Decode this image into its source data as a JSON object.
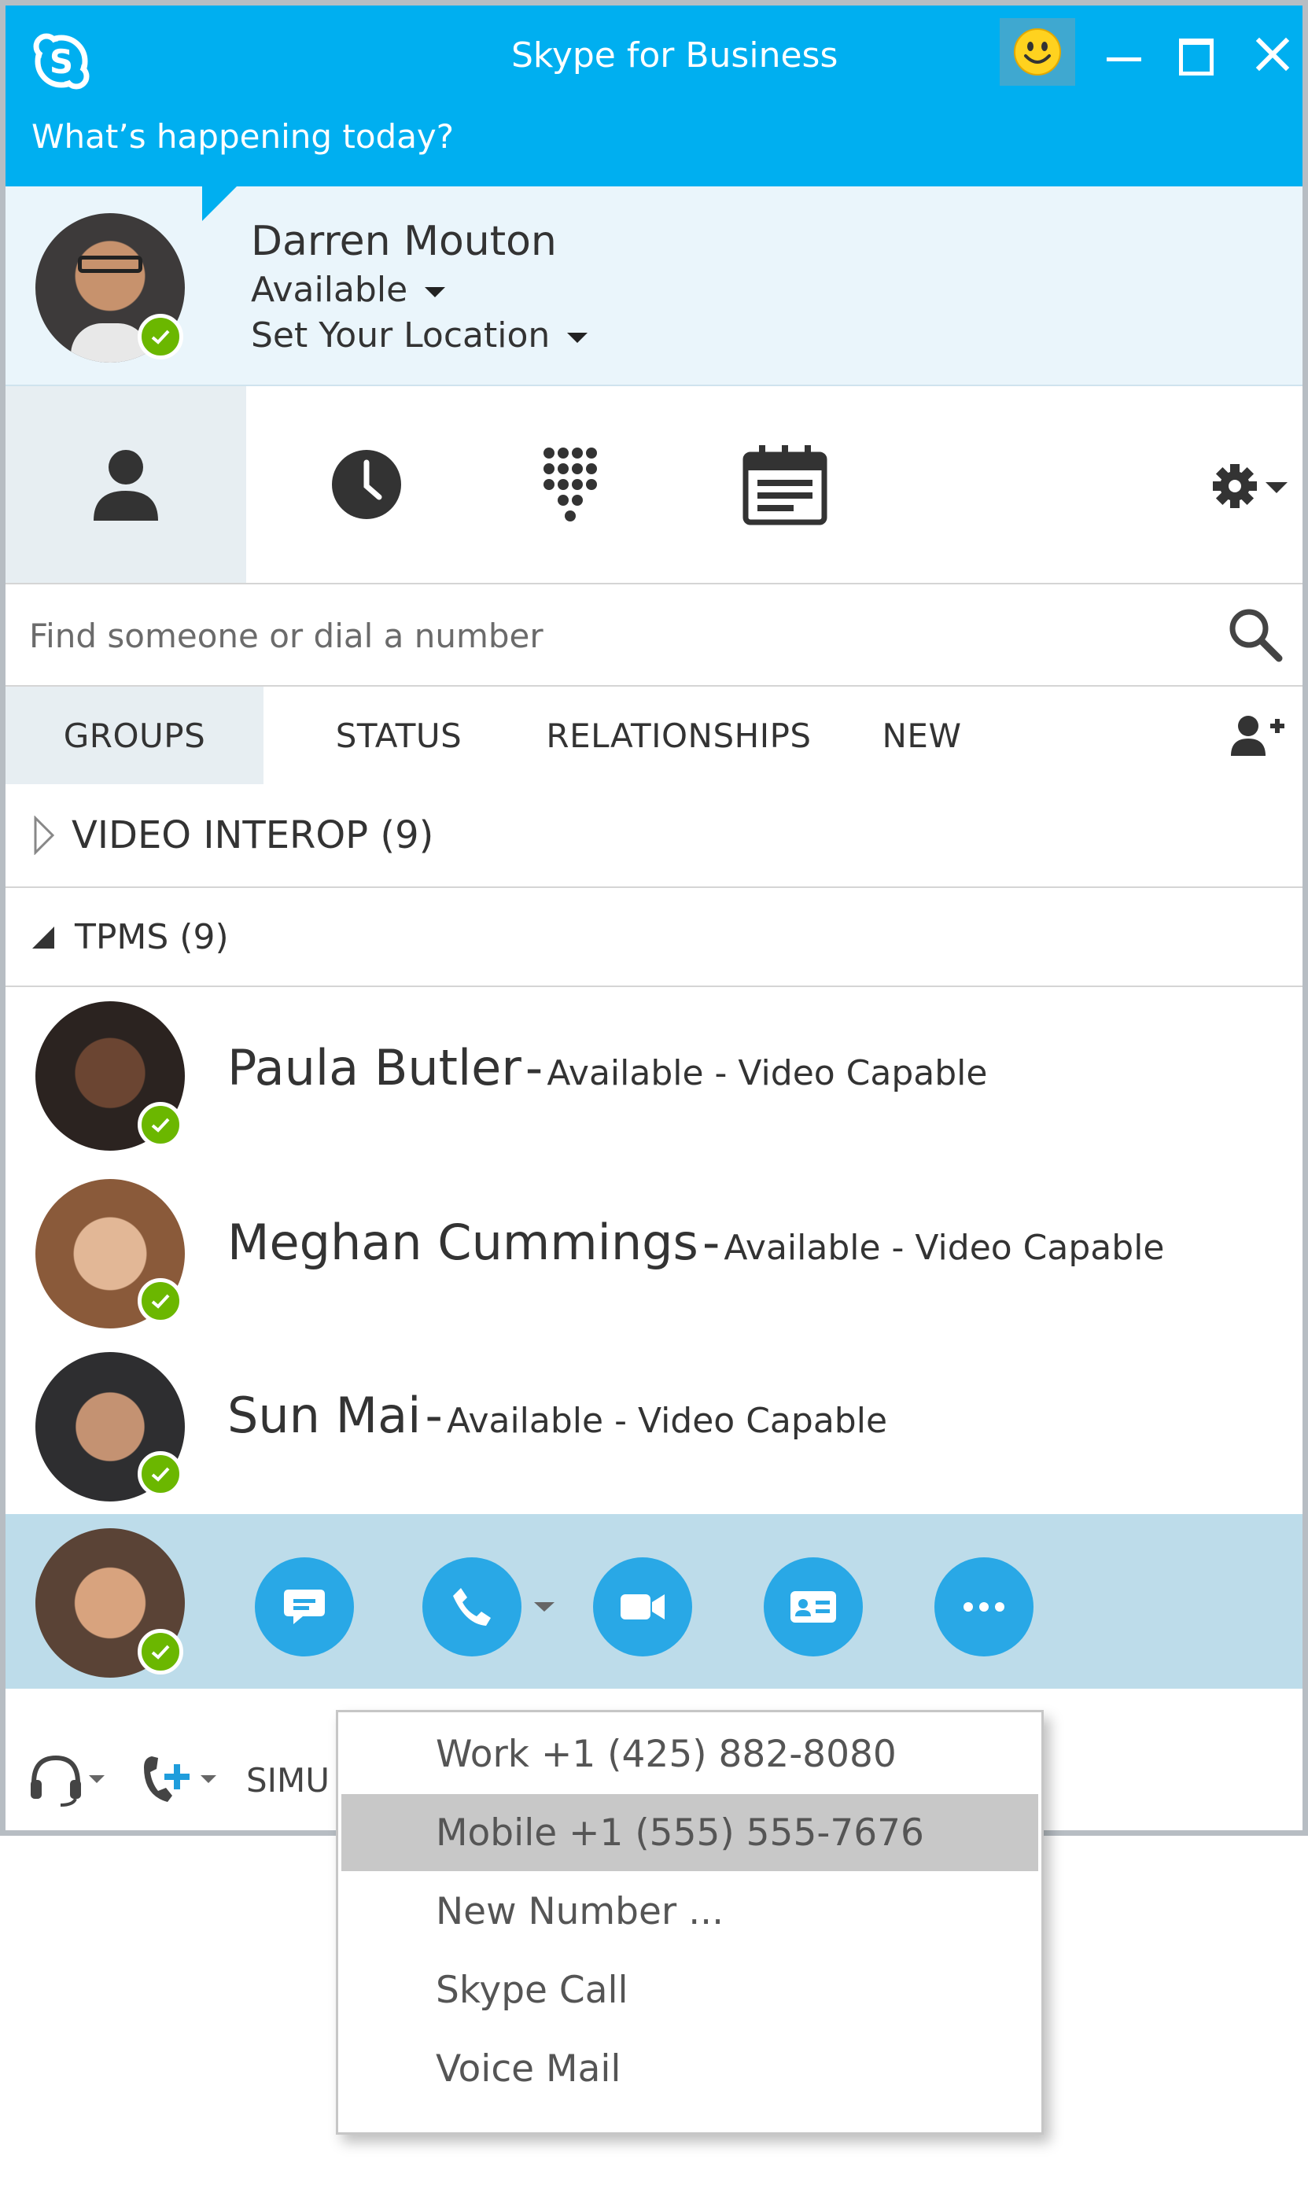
{
  "window": {
    "title": "Skype for Business",
    "minimize": "—",
    "maximize": "☐",
    "close": "X"
  },
  "status_message": {
    "placeholder": "What’s happening today?"
  },
  "me": {
    "name": "Darren Mouton",
    "presence": "Available",
    "location": "Set Your Location"
  },
  "nav": {
    "tabs": [
      {
        "name": "contacts",
        "icon": "person-icon",
        "active": true
      },
      {
        "name": "conversations",
        "icon": "clock-icon",
        "active": false
      },
      {
        "name": "phone",
        "icon": "dialpad-icon",
        "active": false
      },
      {
        "name": "meetings",
        "icon": "calendar-icon",
        "active": false
      }
    ],
    "options_icon": "gear-icon"
  },
  "search": {
    "placeholder": "Find someone or dial a number"
  },
  "contact_tabs": [
    {
      "label": "GROUPS",
      "active": true
    },
    {
      "label": "STATUS",
      "active": false
    },
    {
      "label": "RELATIONSHIPS",
      "active": false
    },
    {
      "label": "NEW",
      "active": false
    }
  ],
  "groups": [
    {
      "label": "VIDEO INTEROP (9)",
      "expanded": false
    },
    {
      "label": "TPMS (9)",
      "expanded": true
    }
  ],
  "contacts": [
    {
      "name": "Paula Butler",
      "sep": "-",
      "status": "Available - Video Capable"
    },
    {
      "name": "Meghan Cummings",
      "sep": "-",
      "status": "Available - Video Capable"
    },
    {
      "name": "Sun Mai",
      "sep": "-",
      "status": "Available - Video Capable"
    }
  ],
  "bottom": {
    "label": "SIMU"
  },
  "call_menu": {
    "items": [
      {
        "label": "Work +1 (425) 882-8080",
        "highlighted": false
      },
      {
        "label": "Mobile +1 (555) 555-7676",
        "highlighted": true
      },
      {
        "label": "New Number ...",
        "highlighted": false
      },
      {
        "label": "Skype Call",
        "highlighted": false
      },
      {
        "label": "Voice Mail",
        "highlighted": false
      }
    ]
  },
  "colors": {
    "brand": "#00aff0",
    "presence_available": "#6bb700",
    "action_button": "#29a8e6",
    "selected_row": "#bddcea"
  }
}
